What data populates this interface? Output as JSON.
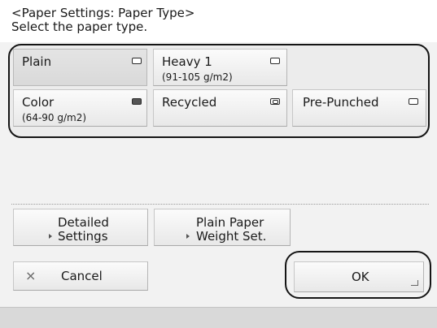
{
  "header": {
    "title": "<Paper Settings: Paper Type>",
    "instruction": "Select the paper type."
  },
  "paper_types": [
    {
      "label": "Plain",
      "sub": "",
      "selected": true,
      "icon": "paper-icon"
    },
    {
      "label": "Heavy 1",
      "sub": "(91-105 g/m2)",
      "selected": false,
      "icon": "paper-icon"
    },
    {
      "label": "Color",
      "sub": "(64-90 g/m2)",
      "selected": false,
      "icon": "color-paper-icon"
    },
    {
      "label": "Recycled",
      "sub": "",
      "selected": false,
      "icon": "recycled-paper-icon"
    },
    {
      "label": "Pre-Punched",
      "sub": "",
      "selected": false,
      "icon": "punched-paper-icon"
    }
  ],
  "options": {
    "detailed_settings": [
      "Detailed",
      "Settings"
    ],
    "plain_paper_weight": [
      "Plain Paper",
      "Weight Set."
    ]
  },
  "actions": {
    "cancel_symbol": "×",
    "cancel": "Cancel",
    "ok": "OK"
  }
}
